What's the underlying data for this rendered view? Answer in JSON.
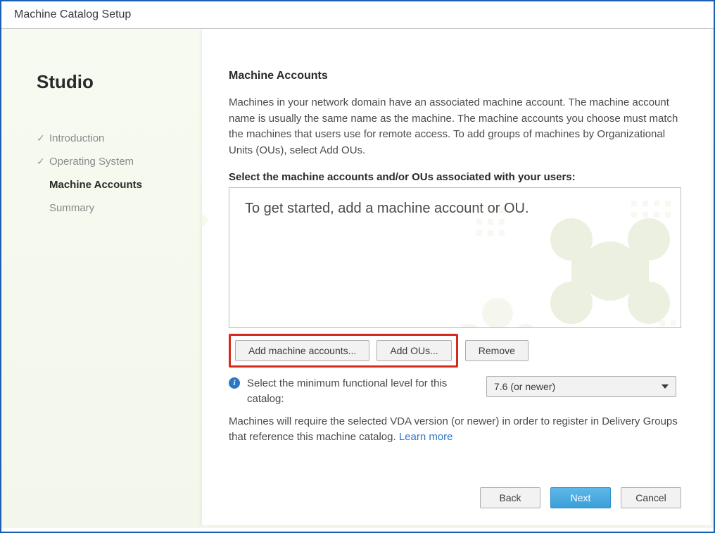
{
  "window": {
    "title": "Machine Catalog Setup"
  },
  "sidebar": {
    "title": "Studio",
    "steps": [
      {
        "label": "Introduction",
        "state": "done"
      },
      {
        "label": "Operating System",
        "state": "done"
      },
      {
        "label": "Machine Accounts",
        "state": "current"
      },
      {
        "label": "Summary",
        "state": "pending"
      }
    ]
  },
  "main": {
    "heading": "Machine Accounts",
    "intro": "Machines in your network domain have an associated machine account. The machine account name is usually the same name as the machine. The machine accounts you choose must match the machines that users use for remote access. To add groups of machines by Organizational Units (OUs), select Add OUs.",
    "select_label": "Select the machine accounts and/or OUs associated with your users:",
    "placeholder_text": "To get started, add a machine account or OU.",
    "buttons": {
      "add_accounts": "Add machine accounts...",
      "add_ous": "Add OUs...",
      "remove": "Remove"
    },
    "functional": {
      "label": "Select the minimum functional level for this catalog:",
      "selected": "7.6 (or newer)"
    },
    "vda_note": "Machines will require the selected VDA version (or newer) in order to register in Delivery Groups that reference this machine catalog. ",
    "learn_more": "Learn more"
  },
  "footer": {
    "back": "Back",
    "next": "Next",
    "cancel": "Cancel"
  }
}
